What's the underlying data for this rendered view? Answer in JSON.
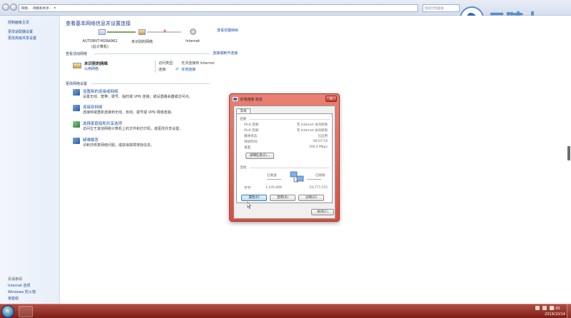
{
  "address": {
    "crumbs": [
      "网络...",
      "网络和共享...",
      "▸"
    ],
    "search_placeholder": "搜索控制面板"
  },
  "logo": {
    "text": "云骑士"
  },
  "sidebar": {
    "items": [
      "控制面板主页",
      "更改适配器设置",
      "更改高级共享设置"
    ],
    "see_also_title": "另请参阅",
    "see_also": [
      "Internet 选项",
      "Windows 防火墙",
      "家庭组"
    ]
  },
  "main": {
    "title": "查看基本网络信息并设置连接",
    "full_map": "查看完整映射",
    "map": {
      "computer": "AUTOBVT-M2RA962",
      "computer_sub": "(此计算机)",
      "network": "未识别的网络",
      "internet": "Internet"
    },
    "active_title": "查看活动网络",
    "connect_disconnect": "连接或断开连接",
    "network_name": "未识别的网络",
    "network_type": "公用网络",
    "access_type_label": "访问类型:",
    "access_type_value": "无法连接到 Internet",
    "connection_label": "连接:",
    "connection_value": "本地连接",
    "change_title": "更改网络设置",
    "tasks": [
      {
        "link": "设置新的连接或网络",
        "desc": "设置无线、宽带、拨号、临时或 VPN 连接；或设置路由器或访问点。"
      },
      {
        "link": "连接到网络",
        "desc": "连接到或重新连接到无线、有线、拨号或 VPN 网络连接。"
      },
      {
        "link": "选择家庭组和共享选项",
        "desc": "访问位于其他网络计算机上的文件和打印机，或更改共享设置。"
      },
      {
        "link": "疑难解答",
        "desc": "诊断并修复网络问题，或获得故障排除信息。"
      }
    ]
  },
  "dialog": {
    "title": "本地连接 状态",
    "close": "x",
    "tab": "常规",
    "connection_group": "连接",
    "rows": [
      {
        "label": "IPv4 连接:",
        "value": "无 Internet 访问权限"
      },
      {
        "label": "IPv6 连接:",
        "value": "无 Internet 访问权限"
      },
      {
        "label": "媒体状态:",
        "value": "已启用"
      },
      {
        "label": "持续时间:",
        "value": "00:07:54"
      },
      {
        "label": "速度:",
        "value": "100.0 Mbps"
      }
    ],
    "details_btn": "详细信息(E)...",
    "activity_group": "活动",
    "sent_label": "已发送",
    "received_label": "已接收",
    "bytes_label": "字节:",
    "bytes_sent": "1,105,608",
    "bytes_received": "19,777,155",
    "properties_btn": "属性(P)",
    "disable_btn": "禁用(D)",
    "diagnose_btn": "诊断(G)",
    "close_btn": "关闭(C)"
  },
  "taskbar": {
    "time": "15:45",
    "date": "2019/10/14"
  },
  "colors": {
    "accent": "#1d4fa0",
    "taskbar": "#9b3a30",
    "dialog_frame": "#d9503f"
  }
}
